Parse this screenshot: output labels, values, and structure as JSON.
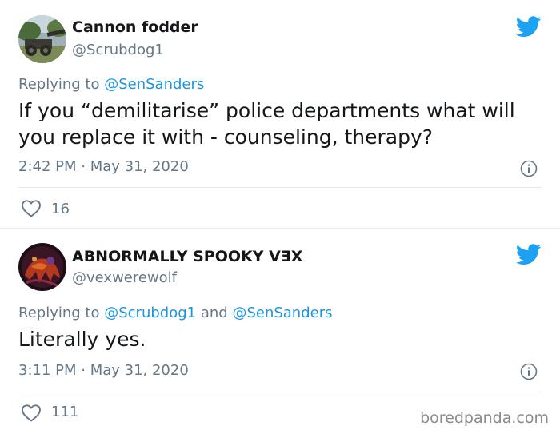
{
  "tweets": [
    {
      "display_name": "Cannon fodder",
      "handle": "@Scrubdog1",
      "replying_label": "Replying to",
      "mentions": [
        "@SenSanders"
      ],
      "text": "If you “demilitarise” police departments what will you replace it with - counseling, therapy?",
      "timestamp": "2:42 PM · May 31, 2020",
      "likes": "16",
      "avatar_icon": "cannon-photo-avatar"
    },
    {
      "display_name": "ABNORMALLY SPOOKY VƎX",
      "handle": "@vexwerewolf",
      "replying_label": "Replying to",
      "mentions": [
        "@Scrubdog1",
        "@SenSanders"
      ],
      "mention_joiner": "and",
      "text": "Literally yes.",
      "timestamp": "3:11 PM · May 31, 2020",
      "likes": "111",
      "avatar_icon": "dark-red-creature-avatar"
    }
  ],
  "watermark": "boredpanda.com",
  "colors": {
    "twitter_blue": "#1da1f2",
    "mention_blue": "#1b95e0",
    "secondary_text": "#657786",
    "primary_text": "#14171a"
  },
  "icons": {
    "brand": "twitter-bird-icon",
    "info": "info-icon",
    "like": "heart-outline-icon"
  }
}
